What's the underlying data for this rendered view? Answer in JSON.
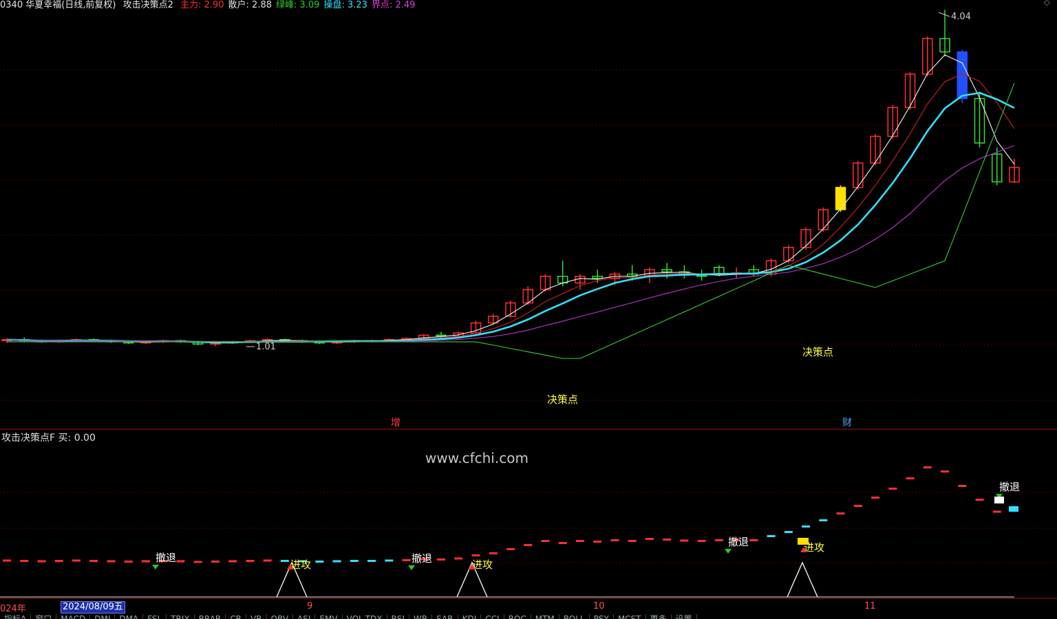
{
  "header": {
    "stock": "0340 华夏幸福(日线,前复权)",
    "indicator": "攻击决策点2",
    "fields": [
      {
        "label": "主力:",
        "value": "2.90",
        "color": "#ff3030"
      },
      {
        "label": "散户:",
        "value": "2.88",
        "color": "#e0e0e0"
      },
      {
        "label": "绿峰:",
        "value": "3.09",
        "color": "#33cc33"
      },
      {
        "label": "操盘:",
        "value": "3.23",
        "color": "#33e0ff"
      },
      {
        "label": "界点:",
        "value": "2.49",
        "color": "#e040e0"
      }
    ]
  },
  "sub_header": {
    "name": "攻击决策点F",
    "buy_label": "买:",
    "buy_value": "0.00"
  },
  "watermark": "www.cfchi.com",
  "x_axis": {
    "year_label": "024年",
    "selected_date": "2024/08/09五",
    "month_labels": [
      "9",
      "10",
      "11"
    ]
  },
  "tabs": [
    "指标A",
    "窗口",
    "MACD",
    "DMI",
    "DMA",
    "FSL",
    "TRIX",
    "BRAR",
    "CR",
    "VR",
    "OBV",
    "ASI",
    "EMV",
    "VOL-TDX",
    "RSI",
    "WR",
    "SAR",
    "KDJ",
    "CCI",
    "ROC",
    "MTM",
    "BOLL",
    "PSY",
    "MCST",
    "更多",
    "设置"
  ],
  "chart_data": [
    {
      "type": "candlestick",
      "title": "",
      "price_annotations": {
        "high": "4.04",
        "low": "1.01"
      },
      "overlay_labels": [
        {
          "text": "决策点",
          "color": "#ffff40"
        },
        {
          "text": "决策点",
          "color": "#ffff40"
        },
        {
          "text": "增",
          "color": "#ff4040"
        },
        {
          "text": "财",
          "color": "#4aa8ff"
        }
      ],
      "series": [
        {
          "name": "主力",
          "color": "#ff3030"
        },
        {
          "name": "散户",
          "color": "#e0e0e0"
        },
        {
          "name": "绿峰",
          "color": "#33cc33"
        },
        {
          "name": "操盘",
          "color": "#33e0ff"
        },
        {
          "name": "界点",
          "color": "#e040e0"
        }
      ],
      "ohlc": [
        [
          1.06,
          1.08,
          1.04,
          1.07
        ],
        [
          1.07,
          1.09,
          1.05,
          1.06
        ],
        [
          1.06,
          1.07,
          1.04,
          1.05
        ],
        [
          1.05,
          1.07,
          1.04,
          1.06
        ],
        [
          1.06,
          1.08,
          1.05,
          1.07
        ],
        [
          1.07,
          1.08,
          1.05,
          1.06
        ],
        [
          1.06,
          1.07,
          1.04,
          1.05
        ],
        [
          1.05,
          1.06,
          1.03,
          1.04
        ],
        [
          1.04,
          1.06,
          1.03,
          1.05
        ],
        [
          1.05,
          1.07,
          1.04,
          1.06
        ],
        [
          1.06,
          1.07,
          1.04,
          1.05
        ],
        [
          1.05,
          1.06,
          1.02,
          1.03
        ],
        [
          1.03,
          1.05,
          1.01,
          1.04
        ],
        [
          1.04,
          1.06,
          1.03,
          1.05
        ],
        [
          1.05,
          1.07,
          1.04,
          1.06
        ],
        [
          1.06,
          1.08,
          1.05,
          1.07
        ],
        [
          1.07,
          1.08,
          1.05,
          1.06
        ],
        [
          1.06,
          1.07,
          1.04,
          1.05
        ],
        [
          1.05,
          1.06,
          1.03,
          1.04
        ],
        [
          1.04,
          1.06,
          1.03,
          1.05
        ],
        [
          1.05,
          1.07,
          1.04,
          1.06
        ],
        [
          1.06,
          1.07,
          1.05,
          1.06
        ],
        [
          1.06,
          1.08,
          1.05,
          1.07
        ],
        [
          1.07,
          1.09,
          1.06,
          1.08
        ],
        [
          1.08,
          1.12,
          1.07,
          1.11
        ],
        [
          1.11,
          1.14,
          1.09,
          1.1
        ],
        [
          1.1,
          1.14,
          1.09,
          1.13
        ],
        [
          1.13,
          1.24,
          1.12,
          1.22
        ],
        [
          1.22,
          1.3,
          1.2,
          1.28
        ],
        [
          1.28,
          1.42,
          1.27,
          1.4
        ],
        [
          1.4,
          1.55,
          1.38,
          1.52
        ],
        [
          1.52,
          1.66,
          1.5,
          1.64
        ],
        [
          1.64,
          1.78,
          1.55,
          1.58
        ],
        [
          1.58,
          1.66,
          1.52,
          1.64
        ],
        [
          1.64,
          1.7,
          1.58,
          1.62
        ],
        [
          1.62,
          1.68,
          1.56,
          1.66
        ],
        [
          1.66,
          1.74,
          1.6,
          1.64
        ],
        [
          1.64,
          1.72,
          1.58,
          1.7
        ],
        [
          1.7,
          1.76,
          1.62,
          1.68
        ],
        [
          1.68,
          1.74,
          1.62,
          1.65
        ],
        [
          1.65,
          1.7,
          1.6,
          1.64
        ],
        [
          1.72,
          1.74,
          1.64,
          1.66
        ],
        [
          1.66,
          1.72,
          1.62,
          1.67
        ],
        [
          1.7,
          1.74,
          1.64,
          1.66
        ],
        [
          1.66,
          1.8,
          1.64,
          1.78
        ],
        [
          1.78,
          1.92,
          1.76,
          1.9
        ],
        [
          1.9,
          2.08,
          1.88,
          2.06
        ],
        [
          2.06,
          2.26,
          2.04,
          2.24
        ],
        [
          2.24,
          2.46,
          2.22,
          2.44
        ],
        [
          2.44,
          2.68,
          2.42,
          2.66
        ],
        [
          2.66,
          2.92,
          2.64,
          2.9
        ],
        [
          2.9,
          3.18,
          2.88,
          3.16
        ],
        [
          3.16,
          3.48,
          3.14,
          3.46
        ],
        [
          3.46,
          3.8,
          3.44,
          3.78
        ],
        [
          3.78,
          4.04,
          3.62,
          3.66
        ],
        [
          3.66,
          3.68,
          3.2,
          3.24
        ],
        [
          3.24,
          3.3,
          2.8,
          2.84
        ],
        [
          2.74,
          2.8,
          2.46,
          2.49
        ],
        [
          2.49,
          2.7,
          2.48,
          2.62
        ]
      ]
    },
    {
      "type": "line",
      "title": "攻击决策点F",
      "markers": [
        {
          "text": "撤退",
          "color": "#ffffff"
        },
        {
          "text": "进攻",
          "color": "#ffff40"
        },
        {
          "text": "撤退",
          "color": "#ffffff"
        },
        {
          "text": "进攻",
          "color": "#ffff40"
        },
        {
          "text": "撤退",
          "color": "#ffffff"
        },
        {
          "text": "进攻",
          "color": "#ffff40"
        },
        {
          "text": "撤退",
          "color": "#ffffff"
        }
      ],
      "signal": {
        "name": "买",
        "values": [
          0,
          1,
          0,
          1,
          0,
          1,
          0
        ]
      }
    }
  ]
}
